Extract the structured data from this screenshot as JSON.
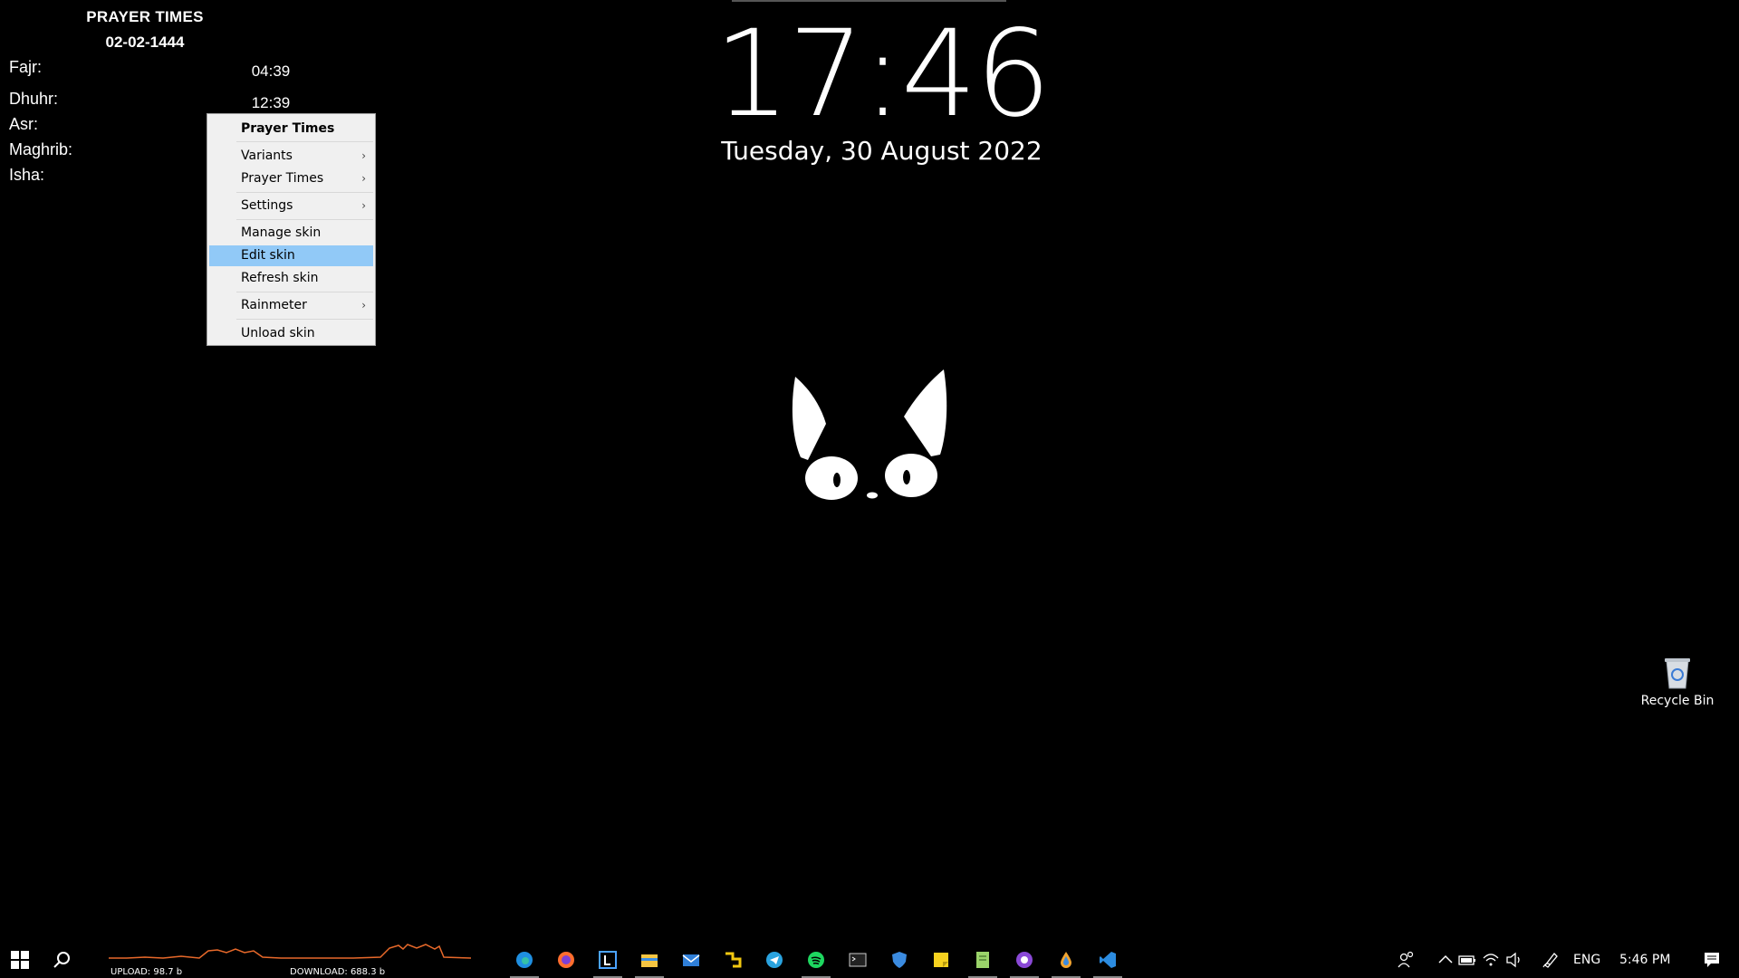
{
  "prayer_widget": {
    "title": "PRAYER TIMES",
    "date": "02-02-1444",
    "rows": [
      {
        "name": "Fajr:",
        "time": "04:39"
      },
      {
        "name": "Dhuhr:",
        "time": "12:39"
      },
      {
        "name": "Asr:",
        "time": ""
      },
      {
        "name": "Maghrib:",
        "time": ""
      },
      {
        "name": "Isha:",
        "time": ""
      }
    ]
  },
  "context_menu": {
    "header": "Prayer Times",
    "items": [
      {
        "label": "Variants",
        "submenu": true
      },
      {
        "label": "Prayer Times",
        "submenu": true
      },
      {
        "label": "Settings",
        "submenu": true
      },
      {
        "label": "Manage skin",
        "submenu": false
      },
      {
        "label": "Edit skin",
        "submenu": false,
        "highlighted": true
      },
      {
        "label": "Refresh skin",
        "submenu": false
      },
      {
        "label": "Rainmeter",
        "submenu": true
      },
      {
        "label": "Unload skin",
        "submenu": false
      }
    ]
  },
  "clock": {
    "time": "17:46",
    "date": "Tuesday, 30 August 2022"
  },
  "desktop": {
    "recycle_bin_label": "Recycle Bin"
  },
  "taskbar": {
    "upload_label": "UPLOAD: 98.7 b",
    "download_label": "DOWNLOAD: 688.3 b",
    "apps": [
      "edge-icon",
      "firefox-icon",
      "bracket-app-icon",
      "file-explorer-icon",
      "mail-icon",
      "app-icon",
      "telegram-icon",
      "spotify-icon",
      "terminal-icon",
      "shield-app-icon",
      "sticky-notes-icon",
      "notepad-icon",
      "github-desktop-icon",
      "drop-app-icon",
      "vscode-icon"
    ],
    "language": "ENG",
    "time": "5:46 PM"
  },
  "colors": {
    "menu_highlight": "#91c9f7",
    "network_graph": "#e8692a"
  }
}
